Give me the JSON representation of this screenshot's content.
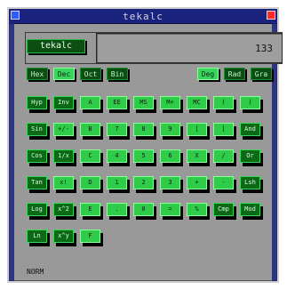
{
  "window": {
    "title": "tekalc"
  },
  "mode_button": {
    "label": "tekalc"
  },
  "display": {
    "value": "133"
  },
  "base_buttons": [
    {
      "label": "Hex",
      "active": false
    },
    {
      "label": "Dec",
      "active": true
    },
    {
      "label": "Oct",
      "active": false
    },
    {
      "label": "Bin",
      "active": false
    }
  ],
  "angle_buttons": [
    {
      "label": "Deg",
      "active": true
    },
    {
      "label": "Rad",
      "active": false
    },
    {
      "label": "Gra",
      "active": false
    }
  ],
  "keypad_rows": [
    [
      "Hyp",
      "Inv",
      "A",
      "EE",
      "MS",
      "M+",
      "MC",
      "(",
      ")"
    ],
    [
      "Sin",
      "+/-",
      "B",
      "7",
      "8",
      "9",
      "[",
      "]",
      "And"
    ],
    [
      "Cos",
      "1/x",
      "C",
      "4",
      "5",
      "6",
      "X",
      "/",
      "Or"
    ],
    [
      "Tan",
      "x!",
      "D",
      "1",
      "2",
      "3",
      "+",
      "-",
      "Lsh"
    ],
    [
      "Log",
      "x^2",
      "E",
      ".",
      "0",
      "=",
      "%",
      "Cmp",
      "Mod"
    ],
    [
      "Ln",
      "x^y",
      "F"
    ]
  ],
  "status": {
    "label": "NORM"
  }
}
